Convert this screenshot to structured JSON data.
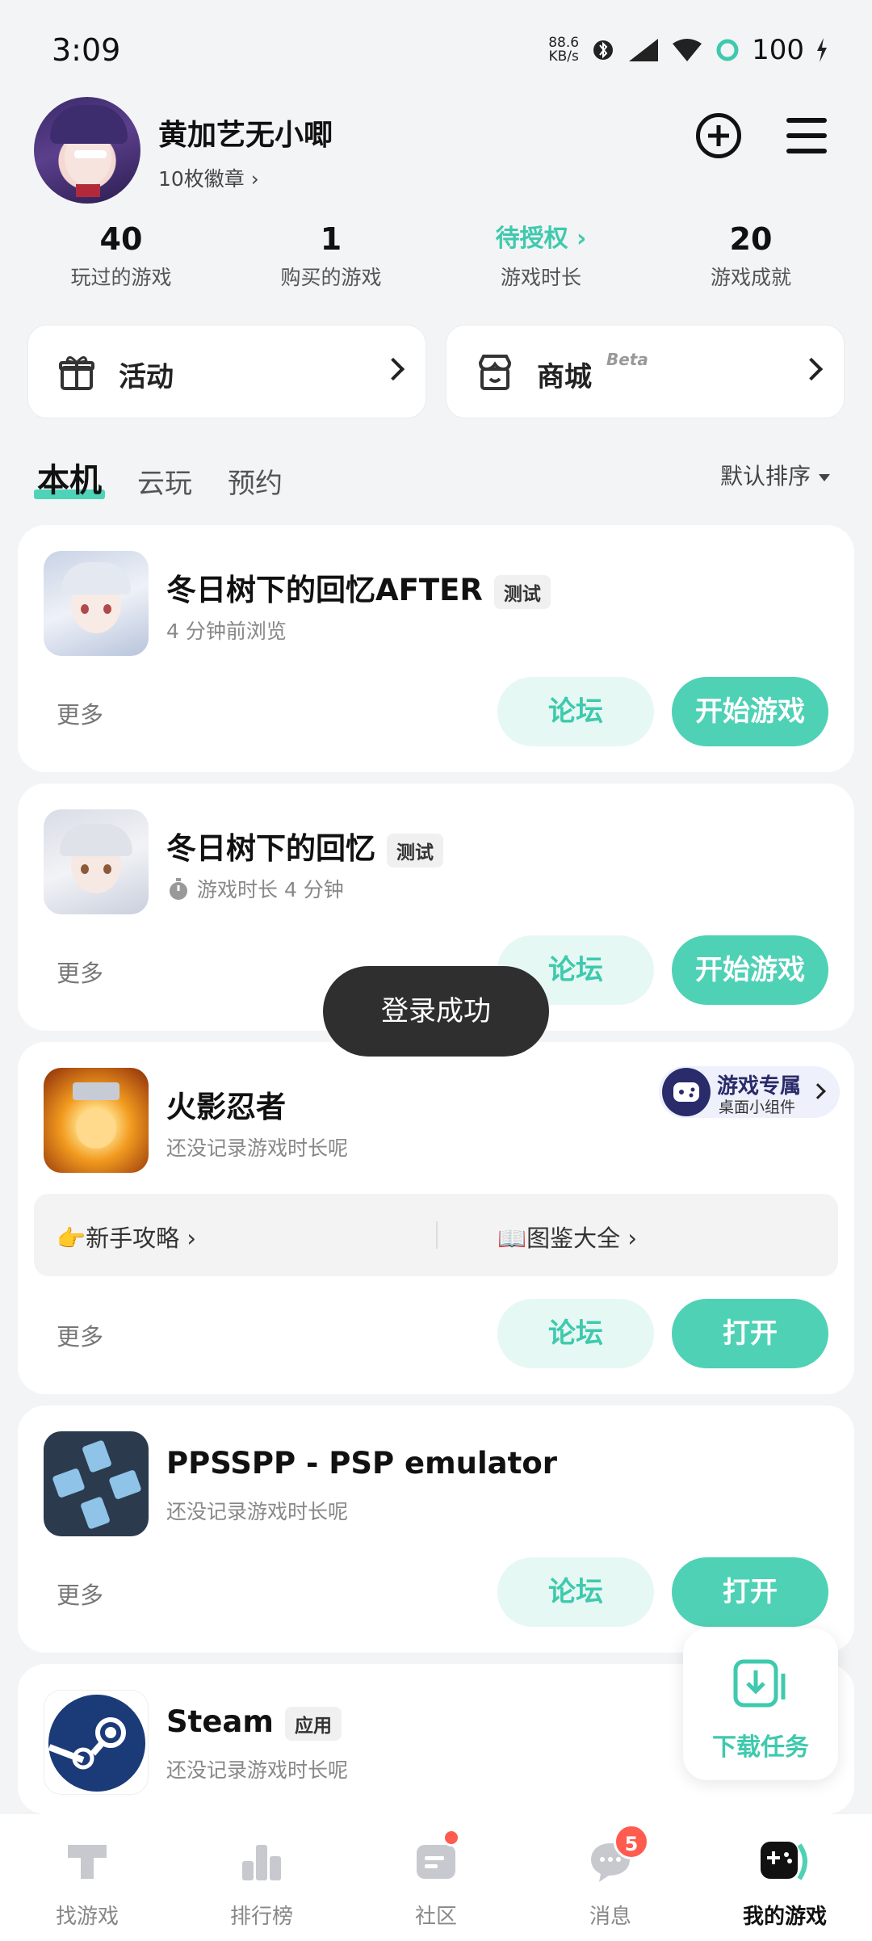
{
  "status_bar": {
    "time": "3:09",
    "net_speed_value": "88.6",
    "net_speed_unit": "KB/s",
    "battery": "100"
  },
  "profile": {
    "username": "黄加艺无小唧",
    "badges": "10枚徽章 ›"
  },
  "stats": [
    {
      "value": "40",
      "label": "玩过的游戏"
    },
    {
      "value": "1",
      "label": "购买的游戏"
    },
    {
      "value": "待授权 ›",
      "label": "游戏时长"
    },
    {
      "value": "20",
      "label": "游戏成就"
    }
  ],
  "quick": {
    "activity_label": "活动",
    "store_label": "商城",
    "store_badge": "Beta"
  },
  "tabs": [
    "本机",
    "云玩",
    "预约"
  ],
  "sort_label": "默认排序",
  "games": [
    {
      "title": "冬日树下的回忆AFTER",
      "tag": "测试",
      "subtitle": "4 分钟前浏览",
      "more": "更多",
      "forum": "论坛",
      "action": "开始游戏"
    },
    {
      "title": "冬日树下的回忆",
      "tag": "测试",
      "subtitle": "游戏时长 4 分钟",
      "more": "更多",
      "forum": "论坛",
      "action": "开始游戏"
    },
    {
      "title": "火影忍者",
      "subtitle": "还没记录游戏时长呢",
      "more": "更多",
      "forum": "论坛",
      "action": "打开",
      "guide_left": "👉新手攻略 ›",
      "guide_right": "📖图鉴大全 ›",
      "widget_title": "游戏专属",
      "widget_sub": "桌面小组件"
    },
    {
      "title": "PPSSPP - PSP emulator",
      "subtitle": "还没记录游戏时长呢",
      "more": "更多",
      "forum": "论坛",
      "action": "打开"
    },
    {
      "title": "Steam",
      "tag": "应用",
      "subtitle": "还没记录游戏时长呢"
    }
  ],
  "toast": "登录成功",
  "download_fab": "下载任务",
  "bottom_nav": [
    {
      "label": "找游戏"
    },
    {
      "label": "排行榜"
    },
    {
      "label": "社区"
    },
    {
      "label": "消息",
      "badge": "5"
    },
    {
      "label": "我的游戏"
    }
  ],
  "colors": {
    "accent": "#4fd1b5",
    "accent_text": "#3fc9ad",
    "badge_red": "#ff5b4f"
  }
}
